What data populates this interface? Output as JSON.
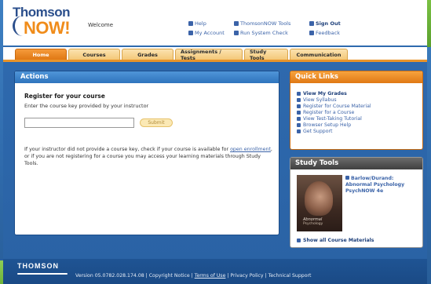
{
  "header": {
    "logo_top": "Thomson",
    "logo_bottom": "NOW!",
    "welcome": "Welcome",
    "links": [
      {
        "label": "Help",
        "icon": "help-icon",
        "bold": false
      },
      {
        "label": "ThomsonNOW Tools",
        "icon": "tools-icon",
        "bold": false
      },
      {
        "label": "Sign Out",
        "icon": "signout-icon",
        "bold": true
      },
      {
        "label": "My Account",
        "icon": "account-icon",
        "bold": false
      },
      {
        "label": "Run System Check",
        "icon": "system-check-icon",
        "bold": false
      },
      {
        "label": "Feedback",
        "icon": "feedback-icon",
        "bold": false
      }
    ]
  },
  "tabs": [
    {
      "label": "Home",
      "active": true
    },
    {
      "label": "Courses",
      "active": false
    },
    {
      "label": "Grades",
      "active": false
    },
    {
      "label": "Assignments / Tests",
      "active": false
    },
    {
      "label": "Study Tools",
      "active": false
    },
    {
      "label": "Communication",
      "active": false
    }
  ],
  "actions": {
    "title": "Actions",
    "register_title": "Register for your course",
    "register_sub": "Enter the course key provided by your instructor",
    "key_value": "",
    "submit_label": "Submit",
    "help_before": "If your instructor did not provide a course key, check if your course is available for ",
    "help_link": "open enrollment",
    "help_after": ", or if you are not registering for a course you may access your learning materials through Study Tools."
  },
  "quick_links": {
    "title": "Quick Links",
    "items": [
      {
        "label": "View My Grades",
        "bold": true
      },
      {
        "label": "View Syllabus",
        "bold": false
      },
      {
        "label": "Register for Course Material",
        "bold": false
      },
      {
        "label": "Register for a Course",
        "bold": false
      },
      {
        "label": "View Test-Taking Tutorial",
        "bold": false
      },
      {
        "label": "Browser Setup Help",
        "bold": false
      },
      {
        "label": "Get Support",
        "bold": false
      }
    ]
  },
  "study_tools": {
    "title": "Study Tools",
    "book_link": "Barlow/Durand: Abnormal Psychology PsychNOW 4e",
    "book_cover_title": "Abnormal",
    "book_cover_sub": "Psychology",
    "show_all": "Show all Course Materials"
  },
  "footer": {
    "logo": "THOMSON",
    "version": "Version 05.0782.028.174.08 | Copyright Notice | ",
    "terms": "Terms of Use",
    "rest": " | Privacy Policy | Technical Support"
  },
  "colors": {
    "brand_blue": "#2b4f8c",
    "brand_orange": "#f08c1a",
    "tab_active": "#e07814",
    "link": "#3b63a8"
  }
}
